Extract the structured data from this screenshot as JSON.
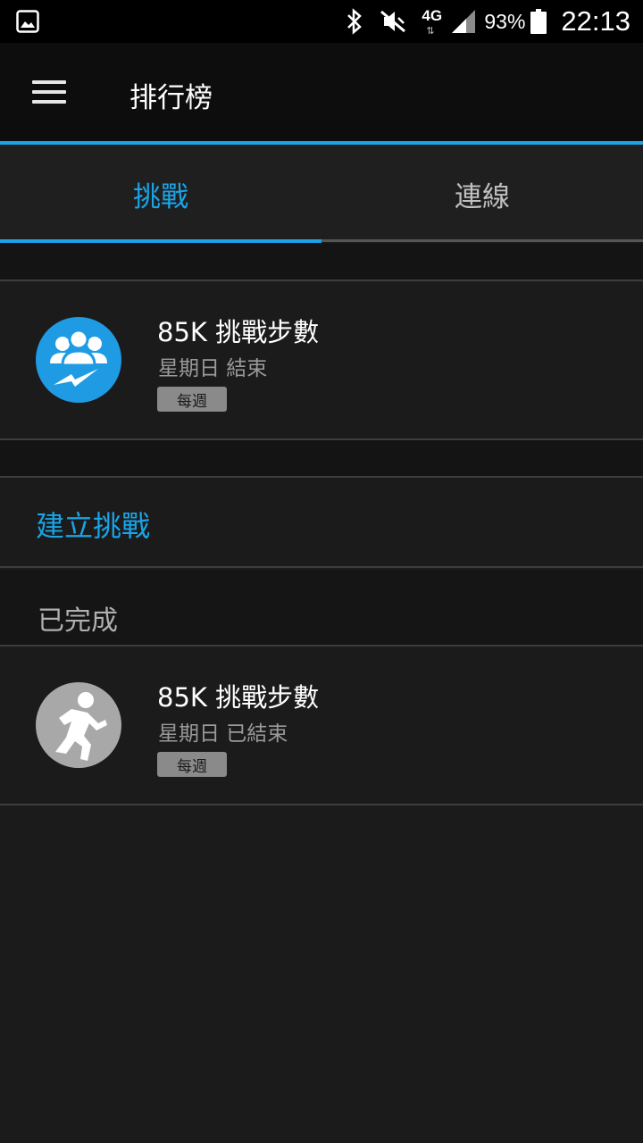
{
  "status_bar": {
    "battery": "93%",
    "time": "22:13",
    "network": "4G",
    "icons": [
      "gallery-icon",
      "bluetooth-icon",
      "mute-icon",
      "network-4g-icon",
      "signal-icon",
      "battery-icon"
    ]
  },
  "app_bar": {
    "title": "排行榜",
    "menu_icon": "menu-icon"
  },
  "tabs": [
    {
      "label": "挑戰",
      "active": true
    },
    {
      "label": "連線",
      "active": false
    }
  ],
  "active_challenges": [
    {
      "title": "85K 挑戰步數",
      "subtitle": "星期日 結束",
      "badge": "每週",
      "icon": "group-icon"
    }
  ],
  "create_challenge": {
    "label": "建立挑戰"
  },
  "completed_section": {
    "label": "已完成",
    "items": [
      {
        "title": "85K 挑戰步數",
        "subtitle": "星期日 已結束",
        "badge": "每週",
        "icon": "runner-icon"
      }
    ]
  },
  "colors": {
    "accent": "#1aa3e6",
    "background": "#1b1b1b",
    "appbar": "#0d0d0d",
    "badge": "#8a8a8a",
    "avatar_active": "#1e9be3",
    "avatar_completed": "#a8a8a8"
  }
}
